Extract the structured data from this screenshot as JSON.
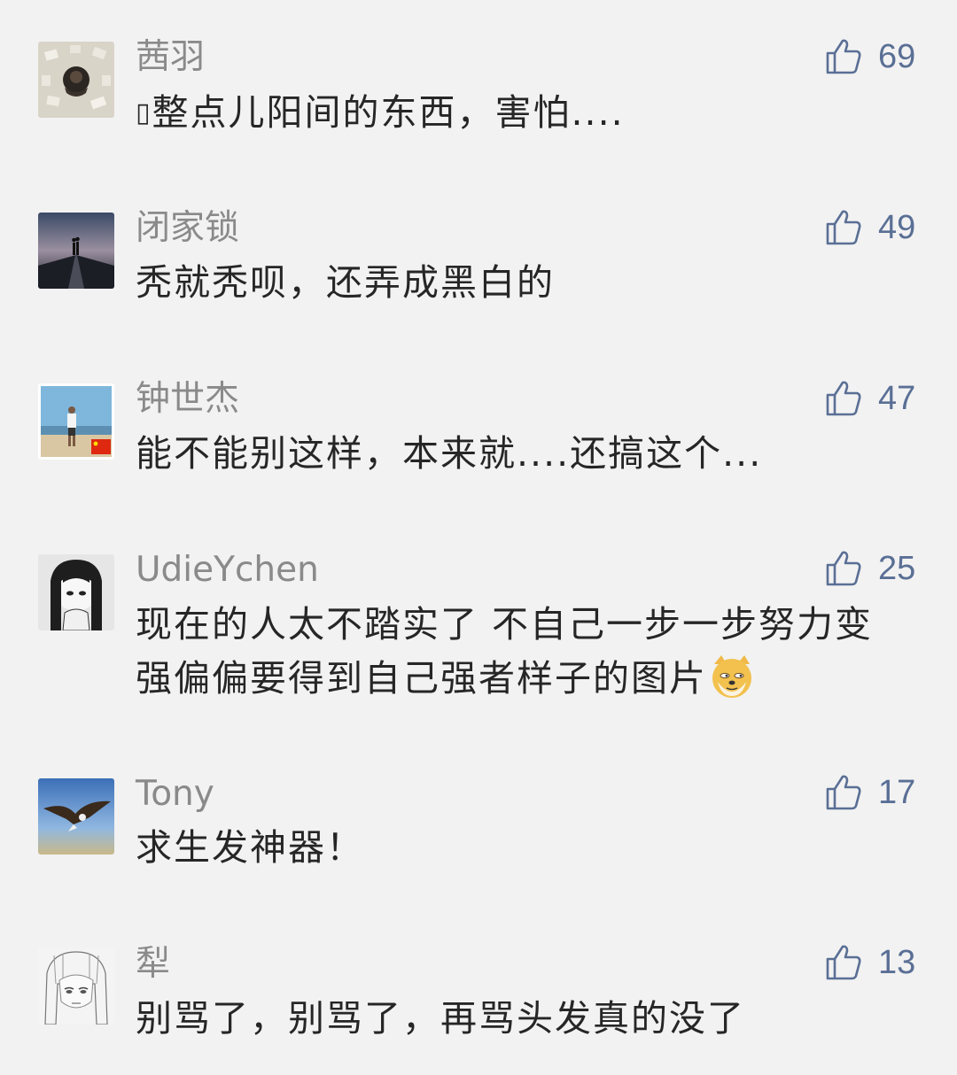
{
  "comments": [
    {
      "username": "茜羽",
      "text": "整点儿阳间的东西，害怕....",
      "text_prefix": "▯",
      "likes": "69"
    },
    {
      "username": "闭家锁",
      "text": "秃就秃呗，还弄成黑白的",
      "likes": "49"
    },
    {
      "username": "钟世杰",
      "text": "能不能别这样，本来就....还搞这个...",
      "likes": "47"
    },
    {
      "username": "UdieYchen",
      "text": "现在的人太不踏实了 不自己一步一步努力变强偏偏要得到自己强者样子的图片",
      "emoji": "doge-emoji",
      "likes": "25"
    },
    {
      "username": "Tony",
      "text": "求生发神器！",
      "likes": "17"
    },
    {
      "username": "犁",
      "text": "别骂了，别骂了，再骂头发真的没了",
      "likes": "13"
    }
  ],
  "icons": {
    "like": "thumbs-up-icon"
  },
  "colors": {
    "background": "#f2f2f2",
    "username": "#8a8a8a",
    "text": "#262626",
    "like": "#5a6f95"
  }
}
